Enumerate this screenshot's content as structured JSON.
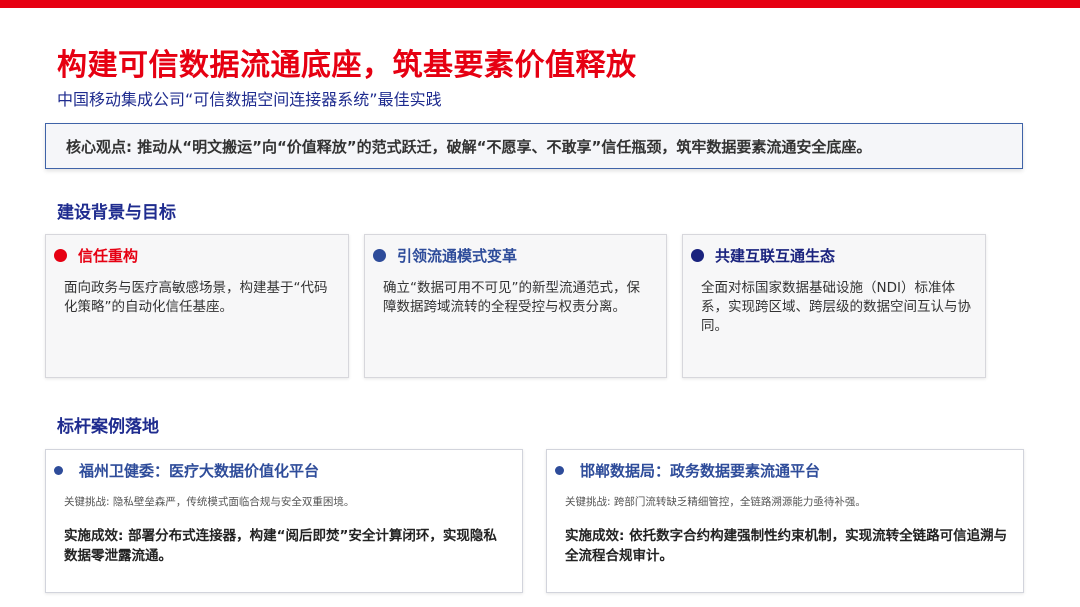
{
  "header": {
    "title": "构建可信数据流通底座，筑基要素价值释放",
    "subtitle": "中国移动集成公司“可信数据空间连接器系统”最佳实践",
    "accent_color": "#e60012"
  },
  "keypoint": {
    "text": "核心观点: 推动从“明文搬运”向“价值释放”的范式跃迁，破解“不愿享、不敢享”信任瓶颈，筑牢数据要素流通安全底座。"
  },
  "background_section": {
    "heading": "建设背景与目标",
    "cards": [
      {
        "title": "信任重构",
        "desc": "面向政务与医疗高敏感场景，构建基于“代码化策略”的自动化信任基座。",
        "color": "#e60012"
      },
      {
        "title": "引领流通模式变革",
        "desc": "确立“数据可用不可见”的新型流通范式，保障数据跨域流转的全程受控与权责分离。",
        "color": "#2e4c9a"
      },
      {
        "title": "共建互联互通生态",
        "desc": "全面对标国家数据基础设施（NDI）标准体系，实现跨区域、跨层级的数据空间互认与协同。",
        "color": "#1a237e"
      }
    ]
  },
  "cases_section": {
    "heading": "标杆案例落地",
    "cases": [
      {
        "title": "福州卫健委：医疗大数据价值化平台",
        "challenge": "关键挑战: 隐私壁垒森严，传统模式面临合规与安全双重困境。",
        "result": "实施成效: 部署分布式连接器，构建“阅后即焚”安全计算闭环，实现隐私数据零泄露流通。"
      },
      {
        "title": "邯郸数据局：政务数据要素流通平台",
        "challenge": "关键挑战: 跨部门流转缺乏精细管控，全链路溯源能力亟待补强。",
        "result": "实施成效: 依托数字合约构建强制性约束机制，实现流转全链路可信追溯与全流程合规审计。"
      }
    ]
  }
}
